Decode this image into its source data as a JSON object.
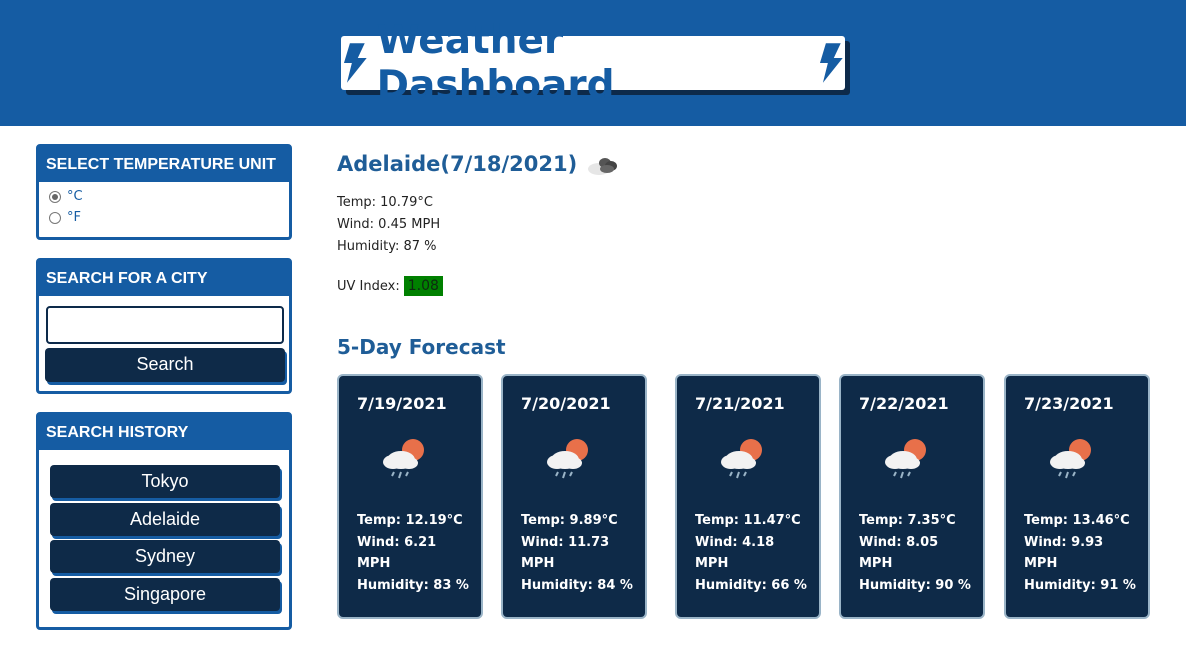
{
  "header": {
    "title": "Weather Dashboard"
  },
  "unit_panel": {
    "heading": "SELECT TEMPERATURE UNIT",
    "options": [
      {
        "label": "°C",
        "checked": true
      },
      {
        "label": "°F",
        "checked": false
      }
    ]
  },
  "search_panel": {
    "heading": "SEARCH FOR A CITY",
    "input_value": "",
    "button_label": "Search"
  },
  "history_panel": {
    "heading": "SEARCH HISTORY",
    "items": [
      "Tokyo",
      "Adelaide",
      "Sydney",
      "Singapore"
    ]
  },
  "current": {
    "title": "Adelaide(7/18/2021)",
    "icon": "cloudy-icon",
    "temp": "Temp: 10.79°C",
    "wind": "Wind: 0.45 MPH",
    "humidity": "Humidity: 87 %",
    "uv_label": "UV Index:",
    "uv_value": "1.08",
    "uv_color": "#008000"
  },
  "forecast": {
    "heading": "5-Day Forecast",
    "days": [
      {
        "date": "7/19/2021",
        "icon": "rain-sun-cloud-icon",
        "temp": "Temp: 12.19°C",
        "wind": "Wind: 6.21",
        "wind_unit": "MPH",
        "humidity": "Humidity: 83 %"
      },
      {
        "date": "7/20/2021",
        "icon": "rain-sun-cloud-icon",
        "temp": "Temp: 9.89°C",
        "wind": "Wind: 11.73",
        "wind_unit": "MPH",
        "humidity": "Humidity: 84 %"
      },
      {
        "date": "7/21/2021",
        "icon": "rain-sun-cloud-icon",
        "temp": "Temp: 11.47°C",
        "wind": "Wind: 4.18",
        "wind_unit": "MPH",
        "humidity": "Humidity: 66 %"
      },
      {
        "date": "7/22/2021",
        "icon": "rain-sun-cloud-icon",
        "temp": "Temp: 7.35°C",
        "wind": "Wind: 8.05",
        "wind_unit": "MPH",
        "humidity": "Humidity: 90 %"
      },
      {
        "date": "7/23/2021",
        "icon": "rain-sun-cloud-icon",
        "temp": "Temp: 13.46°C",
        "wind": "Wind: 9.93",
        "wind_unit": "MPH",
        "humidity": "Humidity: 91 %"
      }
    ]
  },
  "colors": {
    "primary": "#155ca3",
    "dark": "#0e2a48",
    "uv_low": "#008000"
  }
}
